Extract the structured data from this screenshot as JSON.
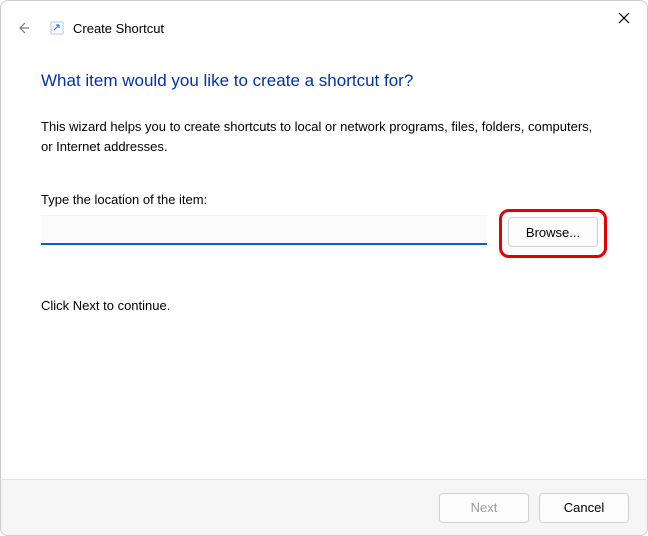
{
  "titlebar": {
    "title": "Create Shortcut"
  },
  "heading": "What item would you like to create a shortcut for?",
  "description": "This wizard helps you to create shortcuts to local or network programs, files, folders, computers, or Internet addresses.",
  "location_label": "Type the location of the item:",
  "location_value": "",
  "browse_label": "Browse...",
  "continue_hint": "Click Next to continue.",
  "footer": {
    "next_label": "Next",
    "cancel_label": "Cancel"
  }
}
